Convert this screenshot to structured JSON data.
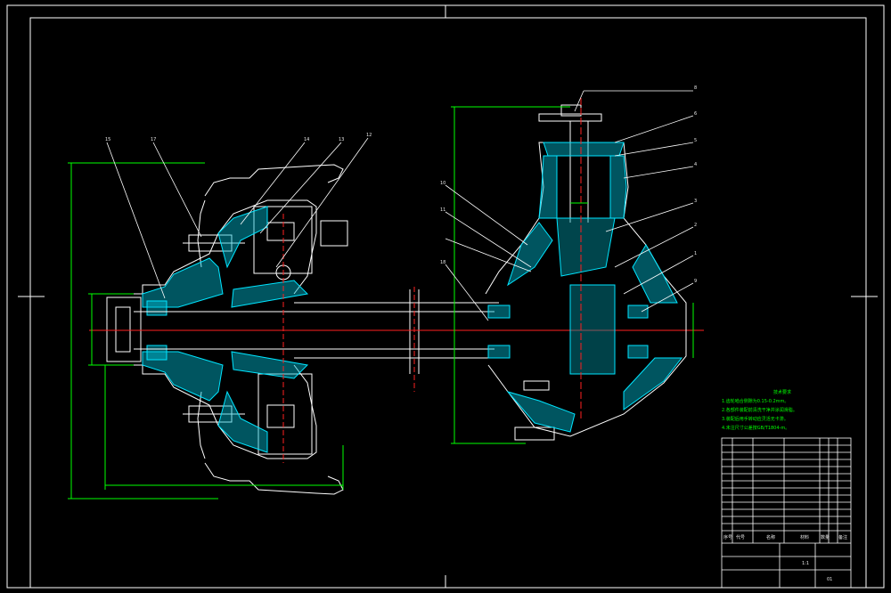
{
  "drawing_title": "",
  "colors": {
    "background": "#000000",
    "frame": "#ffffff",
    "section": "#00e5ff",
    "dimension": "#00ff00",
    "centerline": "#ff2020",
    "hatch": "#00d0ff"
  },
  "balloons_left": [
    "15",
    "17",
    "14",
    "13",
    "12"
  ],
  "balloons_center": [
    "10",
    "11",
    "18"
  ],
  "balloons_right": [
    "8",
    "6",
    "5",
    "4",
    "3",
    "2",
    "1",
    "9"
  ],
  "technical_notes": {
    "title": "技术要求",
    "lines": [
      "1.齿轮啮合侧隙为0.15-0.2mm。",
      "2.各部件装配前清洗干净并涂润滑脂。",
      "3.装配后用手转动应灵活无卡滞。",
      "4.未注尺寸公差按GB/T1804-m。"
    ]
  },
  "title_block": {
    "header": {
      "seq": "序号",
      "code": "代号",
      "name": "名称",
      "qty": "数量",
      "material": "材料",
      "note": "备注"
    },
    "drawing_no": "01",
    "sheet": "1:1"
  }
}
